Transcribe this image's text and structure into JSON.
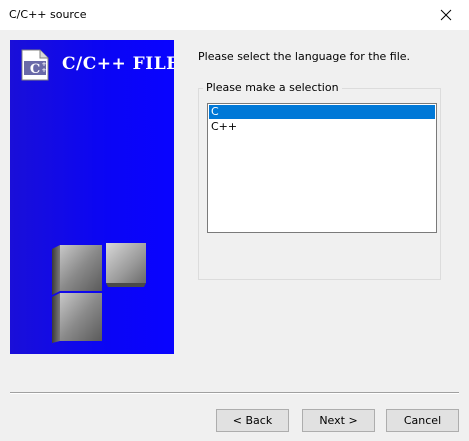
{
  "window": {
    "title": "C/C++ source"
  },
  "side_panel": {
    "logo_text": "C/C++ FILE",
    "logo_icon_letter": "C",
    "background_color": "#0c06f6"
  },
  "content": {
    "instruction": "Please select the language for the file.",
    "group_label": "Please make a selection",
    "options": [
      "C",
      "C++"
    ],
    "selected_option": "C",
    "selection_color": "#0078d7"
  },
  "buttons": {
    "back": "< Back",
    "next": "Next >",
    "cancel": "Cancel"
  }
}
